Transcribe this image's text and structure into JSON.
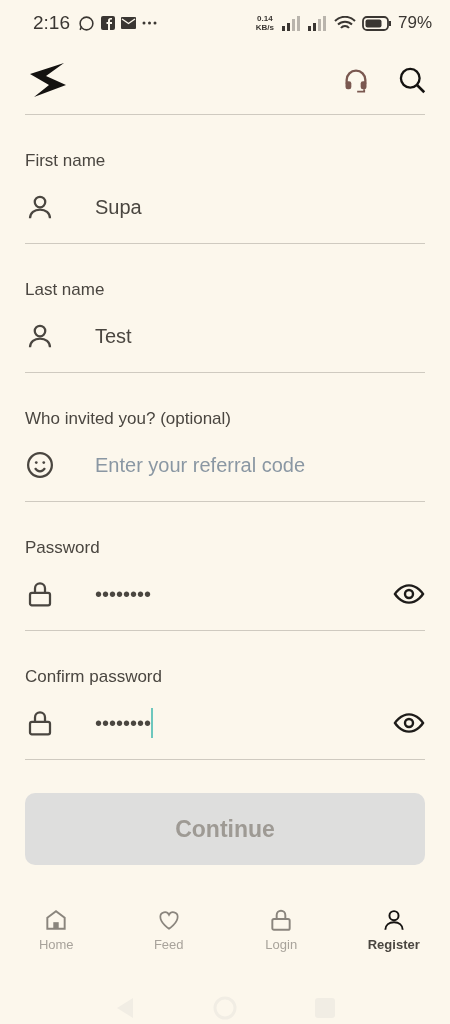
{
  "status_bar": {
    "time": "2:16",
    "speed_value": "0.14",
    "speed_unit": "KB/s",
    "battery": "79%"
  },
  "fields": [
    {
      "label": "First name",
      "kind": "person",
      "value": "Supa",
      "eye": false,
      "focused": false
    },
    {
      "label": "Last name",
      "kind": "person",
      "value": "Test",
      "eye": false,
      "focused": false
    },
    {
      "label": "Who invited you? (optional)",
      "kind": "smiley",
      "placeholder": "Enter your referral code",
      "eye": false,
      "focused": false
    },
    {
      "label": "Password",
      "kind": "lock",
      "value": "••••••••",
      "eye": true,
      "focused": false
    },
    {
      "label": "Confirm password",
      "kind": "lock",
      "value": "••••••••",
      "eye": true,
      "focused": true
    }
  ],
  "continue_button": {
    "label": "Continue",
    "disabled": true
  },
  "nav": [
    {
      "label": "Home",
      "kind": "home",
      "selected": false
    },
    {
      "label": "Feed",
      "kind": "heart",
      "selected": false
    },
    {
      "label": "Login",
      "kind": "lock",
      "selected": false
    },
    {
      "label": "Register",
      "kind": "person",
      "selected": true
    }
  ]
}
